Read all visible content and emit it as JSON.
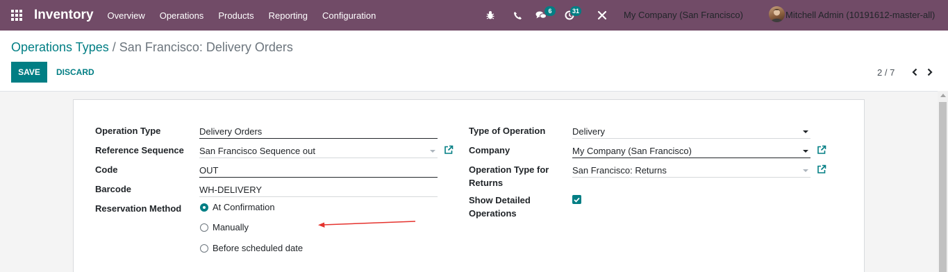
{
  "app": {
    "name": "Inventory",
    "menu": [
      "Overview",
      "Operations",
      "Products",
      "Reporting",
      "Configuration"
    ]
  },
  "systray": {
    "icons": [
      "bug-icon",
      "phone-icon",
      "chat-icon",
      "activity-icon",
      "tools-icon"
    ],
    "messages_count": "6",
    "activities_count": "31",
    "company": "My Company (San Francisco)",
    "user": "Mitchell Admin (10191612-master-all)"
  },
  "breadcrumb": {
    "parent": "Operations Types",
    "separator": "/",
    "current": "San Francisco: Delivery Orders"
  },
  "actions": {
    "save": "SAVE",
    "discard": "DISCARD"
  },
  "pager": {
    "value": "2 / 7"
  },
  "form": {
    "operation_type": {
      "label": "Operation Type",
      "value": "Delivery Orders"
    },
    "reference_sequence": {
      "label": "Reference Sequence",
      "value": "San Francisco Sequence out"
    },
    "code": {
      "label": "Code",
      "value": "OUT"
    },
    "barcode": {
      "label": "Barcode",
      "value": "WH-DELIVERY"
    },
    "reservation_method": {
      "label": "Reservation Method",
      "options": [
        "At Confirmation",
        "Manually",
        "Before scheduled date"
      ],
      "selected": "At Confirmation"
    },
    "type_of_operation": {
      "label": "Type of Operation",
      "value": "Delivery"
    },
    "company": {
      "label": "Company",
      "value": "My Company (San Francisco)"
    },
    "return_type": {
      "label_line1": "Operation Type for",
      "label_line2": "Returns",
      "value": "San Francisco: Returns"
    },
    "show_detailed": {
      "label_line1": "Show Detailed",
      "label_line2": "Operations",
      "checked": true
    }
  },
  "colors": {
    "navbar": "#714b67",
    "primary": "#017e84",
    "annotation": "#e5322d"
  }
}
